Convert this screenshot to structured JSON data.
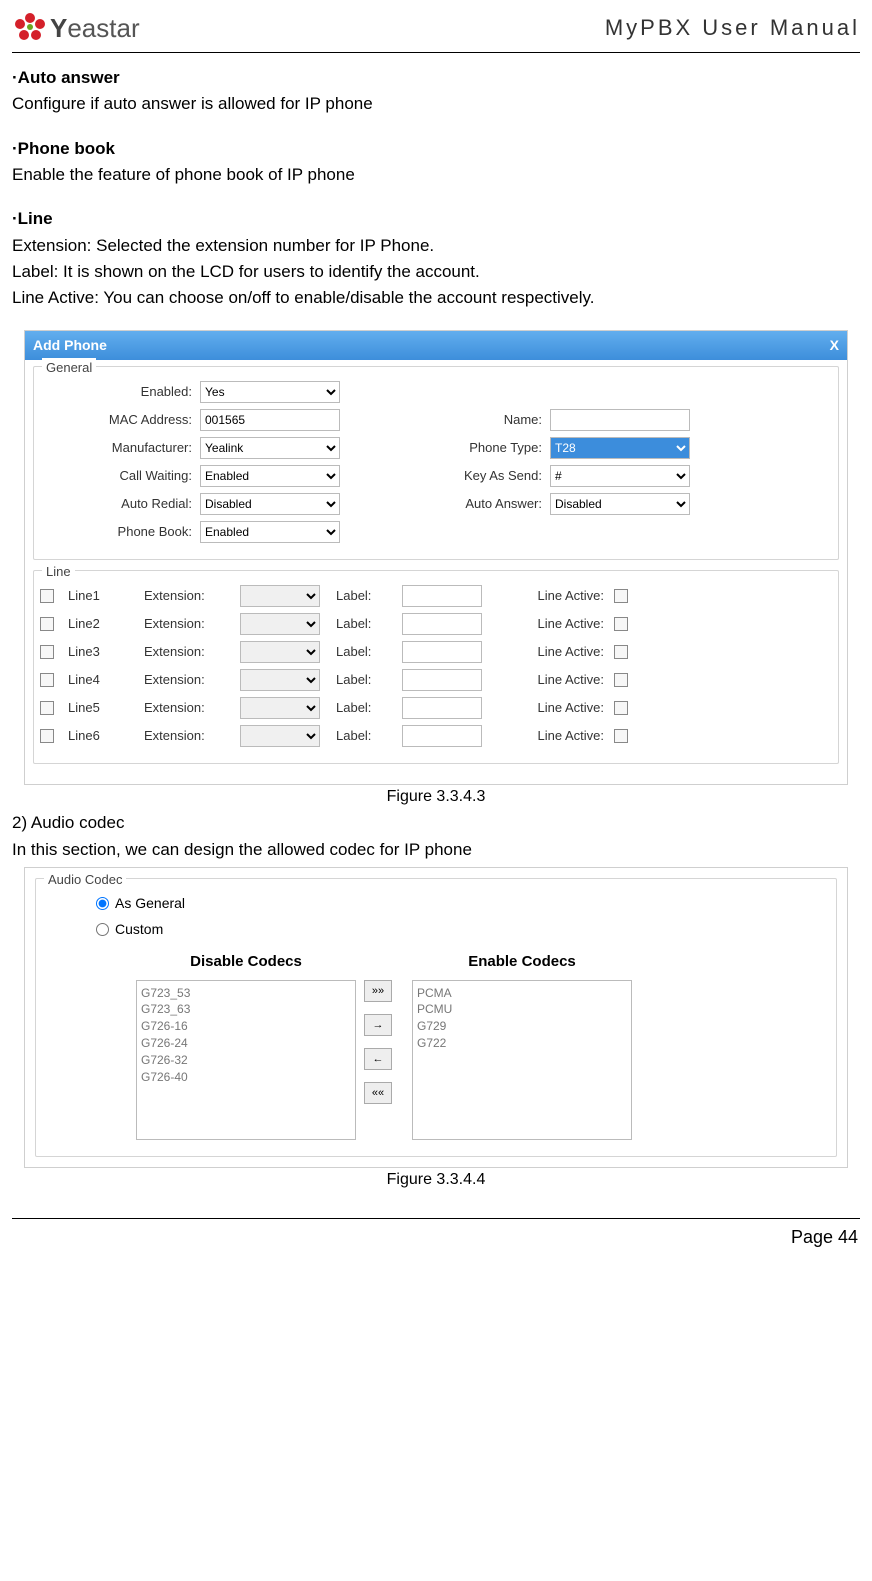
{
  "header": {
    "brand_prefix": "Y",
    "brand_mid": "ea",
    "brand_suffix": "star",
    "title": "MyPBX User Manual"
  },
  "sections": {
    "auto_answer": {
      "head": "·Auto answer",
      "body": "Configure if auto answer is allowed for IP phone"
    },
    "phone_book": {
      "head": "·Phone book",
      "body": "Enable the feature of phone book of IP phone"
    },
    "line": {
      "head": "·Line",
      "l1": "Extension: Selected the extension number for IP Phone.",
      "l2": "Label: It is shown on the LCD for users to identify the account.",
      "l3": "Line Active: You can choose on/off to enable/disable the account respectively."
    },
    "audio": {
      "head": "2)  Audio codec",
      "body": "In this section, we can design the allowed codec for IP phone"
    }
  },
  "add_phone": {
    "title": "Add Phone",
    "close": "X",
    "legend_general": "General",
    "legend_line": "Line",
    "fields": {
      "enabled_label": "Enabled:",
      "enabled_value": "Yes",
      "mac_label": "MAC Address:",
      "mac_value": "001565",
      "name_label": "Name:",
      "name_value": "",
      "manufacturer_label": "Manufacturer:",
      "manufacturer_value": "Yealink",
      "phone_type_label": "Phone Type:",
      "phone_type_value": "T28",
      "call_waiting_label": "Call Waiting:",
      "call_waiting_value": "Enabled",
      "key_as_send_label": "Key As Send:",
      "key_as_send_value": "#",
      "auto_redial_label": "Auto Redial:",
      "auto_redial_value": "Disabled",
      "auto_answer_label": "Auto Answer:",
      "auto_answer_value": "Disabled",
      "phone_book_label": "Phone Book:",
      "phone_book_value": "Enabled"
    },
    "line_labels": {
      "extension": "Extension:",
      "label": "Label:",
      "line_active": "Line Active:"
    },
    "lines": [
      "Line1",
      "Line2",
      "Line3",
      "Line4",
      "Line5",
      "Line6"
    ]
  },
  "fig1": "Figure 3.3.4.3",
  "codec": {
    "legend": "Audio Codec",
    "opt_general": "As General",
    "opt_custom": "Custom",
    "disable_head": "Disable Codecs",
    "enable_head": "Enable Codecs",
    "disabled": [
      "G723_53",
      "G723_63",
      "G726-16",
      "G726-24",
      "G726-32",
      "G726-40"
    ],
    "enabled": [
      "PCMA",
      "PCMU",
      "G729",
      "G722"
    ],
    "btns": {
      "all_right": "»»",
      "right": "→",
      "left": "←",
      "all_left": "««"
    }
  },
  "fig2": "Figure 3.3.4.4",
  "footer": "Page 44"
}
